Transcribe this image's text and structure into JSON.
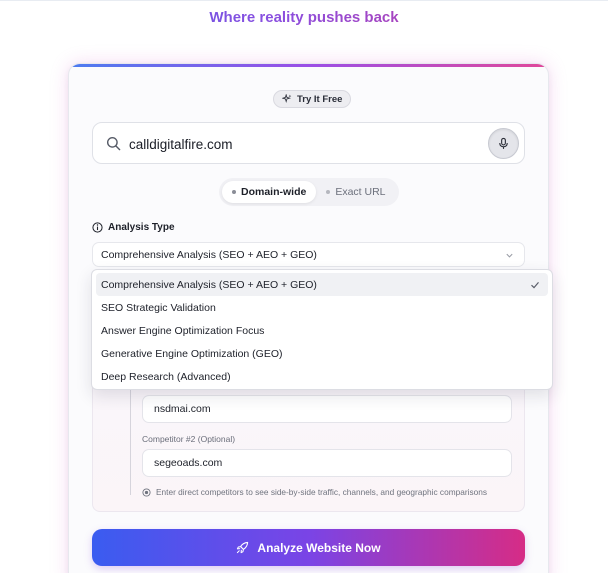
{
  "header": {
    "headline": "Where reality pushes back"
  },
  "badge": {
    "label": "Try It Free",
    "icon": "sparkle-icon"
  },
  "search": {
    "value": "calldigitalfire.com",
    "icon": "search-icon",
    "mic_icon": "microphone-icon"
  },
  "scope_toggle": {
    "options": [
      {
        "label": "Domain-wide",
        "active": true
      },
      {
        "label": "Exact URL",
        "active": false
      }
    ]
  },
  "analysis": {
    "label": "Analysis Type",
    "icon": "info-icon",
    "selected": "Comprehensive Analysis (SEO + AEO + GEO)",
    "options": [
      "Comprehensive Analysis (SEO + AEO + GEO)",
      "SEO Strategic Validation",
      "Answer Engine Optimization Focus",
      "Generative Engine Optimization (GEO)",
      "Deep Research (Advanced)"
    ]
  },
  "competitors": {
    "competitor_1_value": "nsdmai.com",
    "competitor_2_label": "Competitor #2 (Optional)",
    "competitor_2_value": "segeoads.com",
    "hint": "Enter direct competitors to see side-by-side traffic, channels, and geographic comparisons"
  },
  "cta": {
    "label": "Analyze Website Now",
    "icon": "rocket-icon"
  },
  "colors": {
    "accent_start": "#3a5cf0",
    "accent_mid": "#7a44e6",
    "accent_end": "#d62c86"
  }
}
